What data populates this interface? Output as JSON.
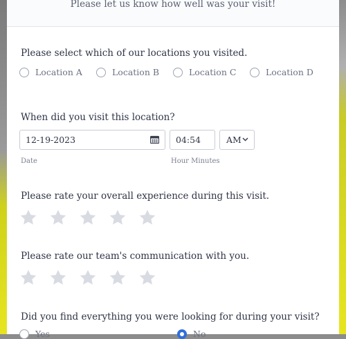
{
  "header": {
    "title": "Please let us know how well was your visit!"
  },
  "locations": {
    "question": "Please select which of our locations you visited.",
    "options": [
      "Location A",
      "Location B",
      "Location C",
      "Location D"
    ]
  },
  "visit_time": {
    "question": "When did you visit this location?",
    "date_value": "12-19-2023",
    "date_label": "Date",
    "time_value": "04:54",
    "time_label": "Hour Minutes",
    "ampm_value": "AM"
  },
  "overall_rating": {
    "question": "Please rate your overall experience during this visit.",
    "stars": 5,
    "selected": 0
  },
  "communication_rating": {
    "question": "Please rate our team's communication with you.",
    "stars": 5,
    "selected": 0
  },
  "found_everything": {
    "question": "Did you find everything you were looking for during your visit?",
    "options": [
      "Yes",
      "No"
    ],
    "selected": "No"
  },
  "colors": {
    "accent": "#2f6fdc",
    "star_empty": "#d9dbe3",
    "text": "#2f3446",
    "muted": "#6a7081"
  }
}
